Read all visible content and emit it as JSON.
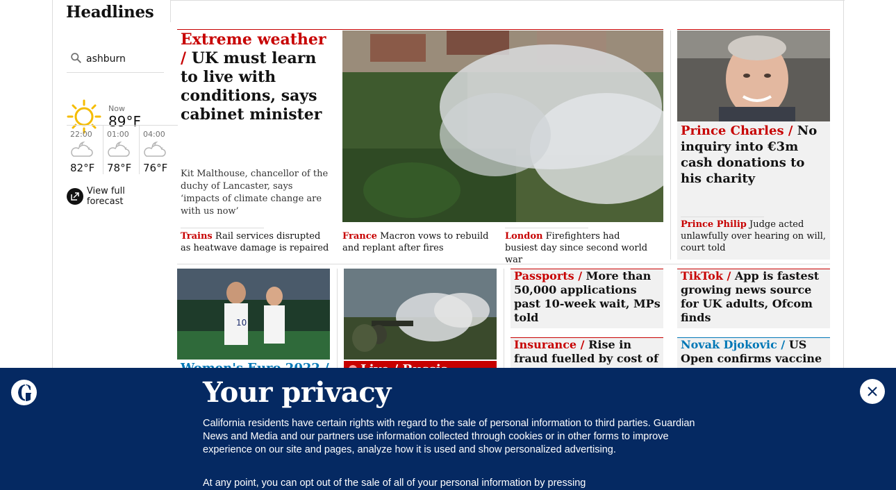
{
  "section": {
    "title": "Headlines"
  },
  "weather": {
    "location": "ashburn",
    "now_label": "Now",
    "now_temp": "89°F",
    "forecast": [
      {
        "time": "22:00",
        "temp": "82°F",
        "icon": "cloud-moon-icon"
      },
      {
        "time": "01:00",
        "temp": "78°F",
        "icon": "cloud-moon-icon"
      },
      {
        "time": "04:00",
        "temp": "76°F",
        "icon": "cloud-moon-icon"
      }
    ],
    "view_forecast": "View full forecast"
  },
  "main_story": {
    "kicker": "Extreme weather /",
    "headline": "UK must learn to live with conditions, says cabinet minister",
    "standfirst": "Kit Malthouse, chancellor of the duchy of Lancaster, says ‘impacts of climate change are with us now’"
  },
  "sublinks": [
    {
      "kicker": "Trains",
      "text": "Rail services disrupted as heatwave damage is repaired"
    },
    {
      "kicker": "France",
      "text": "Macron vows to rebuild and replant after fires"
    },
    {
      "kicker": "London",
      "text": "Firefighters had busiest day since second world war"
    }
  ],
  "right_story": {
    "kicker": "Prince Charles /",
    "headline": "No inquiry into €3m cash donations to his charity",
    "sub_kicker": "Prince Philip",
    "sub_text": "Judge acted unlawfully over hearing on will, court told"
  },
  "row2": [
    {
      "kicker": "Passports /",
      "headline": "More than 50,000 applications past 10-week wait, MPs told"
    },
    {
      "kicker": "TikTok /",
      "headline": "App is fastest growing news source for UK adults, Ofcom finds"
    },
    {
      "kicker": "Insurance /",
      "headline": "Rise in fraud fuelled by cost of living"
    },
    {
      "kicker": "Novak Djokovic /",
      "headline": "US Open confirms vaccine status"
    }
  ],
  "partial": {
    "womens_kicker": "Women's Euro 2022 /",
    "live_label": "Live / Russia"
  },
  "privacy": {
    "title": "Your privacy",
    "body": "California residents have certain rights with regard to the sale of personal information to third parties. Guardian News and Media and our partners use information collected through cookies or in other forms to improve experience on our site and pages, analyze how it is used and show personalized advertising.",
    "body2": "At any point, you can opt out of the sale of all of your personal information by pressing"
  },
  "colors": {
    "news_red": "#c70000",
    "brand_blue": "#052962",
    "sport_blue": "#0077b6",
    "card_gray": "#f1f1f1"
  }
}
